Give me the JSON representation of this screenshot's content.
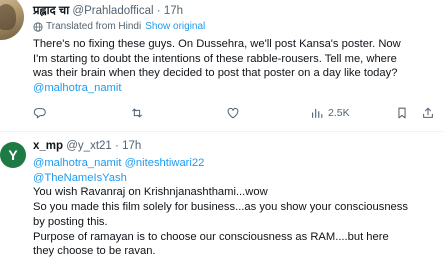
{
  "tweet1": {
    "display_name": "प्रह्लाद चा",
    "handle": "@Prahladoffical",
    "separator": "·",
    "time": "17h",
    "translated_label": "Translated from Hindi",
    "show_original_label": "Show original",
    "lines": [
      "There's no fixing these guys. On Dussehra, we'll post Kansa's poster. Now",
      "I'm starting to doubt the intentions of these rabble-rousers. Tell me, where",
      "was their brain when they decided to post that poster on a day like today?"
    ],
    "mention_line": "@malhotra_namit",
    "views": "2.5K",
    "icons": [
      "reply-icon",
      "retweet-icon",
      "like-icon",
      "views-icon",
      "bookmark-icon"
    ]
  },
  "tweet2": {
    "avatar_letter": "Y",
    "avatar_color": "#1e7a44",
    "display_name": "x_mp",
    "handle": "@y_xt21",
    "separator": "·",
    "time": "17h",
    "mentions_line1": "@malhotra_namit @niteshtiwari22",
    "mentions_line2": "@TheNameIsYash",
    "lines": [
      "You wish Ravanraj on Krishnjanashthami...wow",
      "So you made this film solely for business...as you show your consciousness",
      "by posting this.",
      "Purpose of ramayan is to choose our consciousness as RAM....but here",
      "they choose to be ravan."
    ]
  },
  "colors": {
    "text": "#0f1419",
    "muted": "#536471",
    "link": "#1d9bf0",
    "divider": "#eff3f4"
  }
}
